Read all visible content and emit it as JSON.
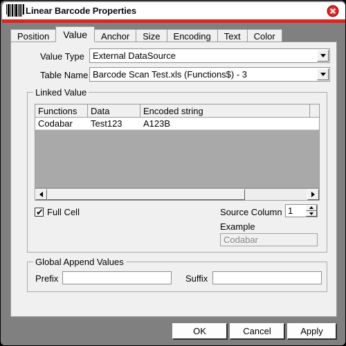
{
  "window": {
    "title": "Linear Barcode Properties",
    "icon": "barcode-icon",
    "close_icon": "close-icon",
    "accent_color": "#e8201a",
    "frame_color": "#808080"
  },
  "tabs": [
    {
      "label": "Position",
      "selected": false
    },
    {
      "label": "Value",
      "selected": true
    },
    {
      "label": "Anchor",
      "selected": false
    },
    {
      "label": "Size",
      "selected": false
    },
    {
      "label": "Encoding",
      "selected": false
    },
    {
      "label": "Text",
      "selected": false
    },
    {
      "label": "Color",
      "selected": false
    }
  ],
  "value_tab": {
    "value_type": {
      "label": "Value Type",
      "value": "External DataSource",
      "arrow_icon": "chevron-down-icon"
    },
    "table_name": {
      "label": "Table Name",
      "value": "Barcode Scan Test.xls (Functions$) - 3",
      "arrow_icon": "chevron-down-icon"
    },
    "linked_value": {
      "title": "Linked Value",
      "columns": [
        "Functions",
        "Data",
        "Encoded string"
      ],
      "rows": [
        [
          "Codabar",
          "Test123",
          "A123B"
        ]
      ],
      "scrollbar": {
        "left_icon": "arrow-left-icon",
        "right_icon": "arrow-right-icon"
      },
      "full_cell": {
        "label": "Full Cell",
        "checked": true,
        "check_glyph": "✔"
      },
      "source_column": {
        "label": "Source Column",
        "value": "1",
        "up_icon": "spinner-up-icon",
        "down_icon": "spinner-down-icon"
      },
      "example": {
        "label": "Example",
        "value": "Codabar"
      }
    },
    "global_append": {
      "title": "Global Append Values",
      "prefix": {
        "label": "Prefix",
        "value": "",
        "placeholder": ""
      },
      "suffix": {
        "label": "Suffix",
        "value": "",
        "placeholder": ""
      }
    }
  },
  "buttons": {
    "ok": "OK",
    "cancel": "Cancel",
    "apply": "Apply"
  }
}
